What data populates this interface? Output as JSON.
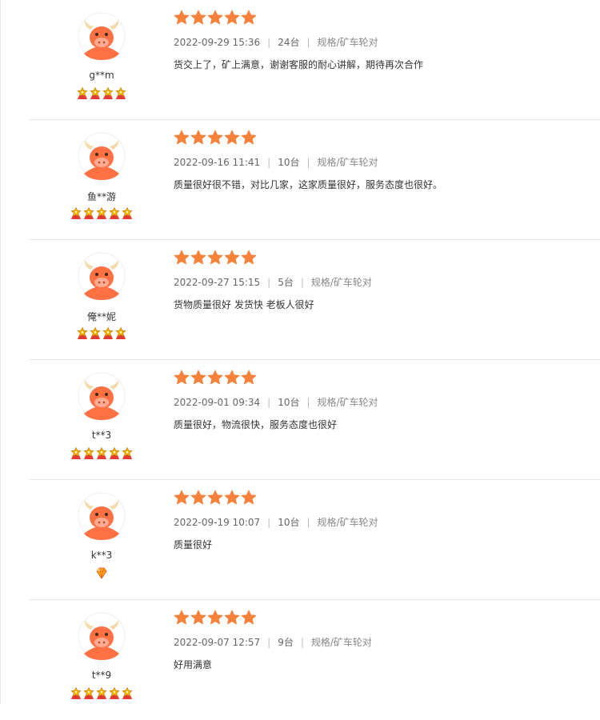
{
  "reviews": [
    {
      "username": "g**m",
      "medal": "crown",
      "medal_count": 4,
      "stars": 5,
      "date": "2022-09-29 15:36",
      "quantity": "24台",
      "spec": "规格/矿车轮对",
      "comment": "货交上了，矿上满意，谢谢客服的耐心讲解，期待再次合作"
    },
    {
      "username": "鱼**游",
      "medal": "crown",
      "medal_count": 5,
      "stars": 5,
      "date": "2022-09-16 11:41",
      "quantity": "10台",
      "spec": "规格/矿车轮对",
      "comment": "质量很好很不错，对比几家，这家质量很好，服务态度也很好。"
    },
    {
      "username": "俺**妮",
      "medal": "crown",
      "medal_count": 4,
      "stars": 5,
      "date": "2022-09-27 15:15",
      "quantity": "5台",
      "spec": "规格/矿车轮对",
      "comment": "货物质量很好 发货快 老板人很好"
    },
    {
      "username": "t**3",
      "medal": "crown",
      "medal_count": 5,
      "stars": 5,
      "date": "2022-09-01 09:34",
      "quantity": "10台",
      "spec": "规格/矿车轮对",
      "comment": "质量很好，物流很快，服务态度也很好"
    },
    {
      "username": "k**3",
      "medal": "diamond",
      "medal_count": 1,
      "stars": 5,
      "date": "2022-09-19 10:07",
      "quantity": "10台",
      "spec": "规格/矿车轮对",
      "comment": "质量很好"
    },
    {
      "username": "t**9",
      "medal": "crown",
      "medal_count": 5,
      "stars": 5,
      "date": "2022-09-07 12:57",
      "quantity": "9台",
      "spec": "规格/矿车轮对",
      "comment": "好用满意"
    }
  ],
  "colors": {
    "star": "#f6813a",
    "avatar_bg": "#ff7043",
    "medal_gold": "#f5b400",
    "medal_red": "#e53935",
    "diamond": "#ffa726"
  },
  "icons": {
    "star": "star-icon",
    "avatar": "bull-avatar-icon",
    "crown": "crown-medal-icon",
    "diamond": "diamond-medal-icon"
  }
}
